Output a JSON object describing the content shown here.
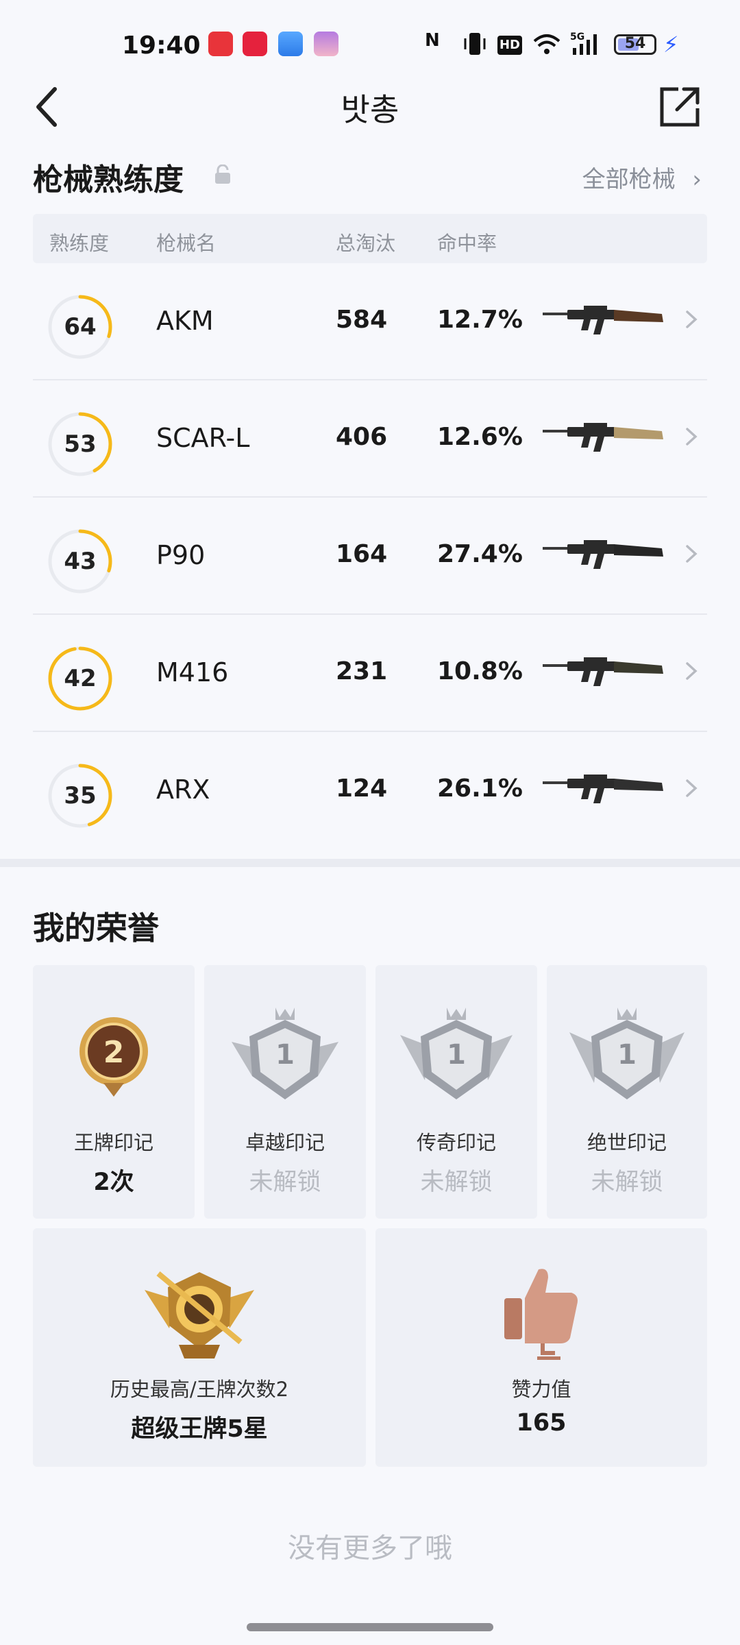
{
  "status_bar": {
    "time": "19:40",
    "battery": "54",
    "icons": [
      "nfc-icon",
      "vibrate-icon",
      "hd-icon",
      "wifi-icon",
      "5g-signal-icon",
      "battery-icon",
      "charging-icon"
    ]
  },
  "nav": {
    "title": "밧총",
    "back_icon": "chevron-left-icon",
    "share_icon": "share-icon"
  },
  "guns": {
    "heading": "枪械熟练度",
    "all_link": "全部枪械",
    "columns": [
      "熟练度",
      "枪械名",
      "总淘汰",
      "命中率"
    ],
    "rows": [
      {
        "level": "64",
        "level_value": 64,
        "name": "AKM",
        "kills": "584",
        "rate": "12.7%",
        "image": "akm-rifle-icon"
      },
      {
        "level": "53",
        "level_value": 53,
        "name": "SCAR-L",
        "kills": "406",
        "rate": "12.6%",
        "image": "scar-l-rifle-icon"
      },
      {
        "level": "43",
        "level_value": 43,
        "name": "P90",
        "kills": "164",
        "rate": "27.4%",
        "image": "p90-smg-icon"
      },
      {
        "level": "42",
        "level_value": 42,
        "name": "M416",
        "kills": "231",
        "rate": "10.8%",
        "image": "m416-rifle-icon"
      },
      {
        "level": "35",
        "level_value": 35,
        "name": "ARX",
        "kills": "124",
        "rate": "26.1%",
        "image": "arx-rifle-icon"
      }
    ],
    "ring_progress": [
      0.3,
      0.42,
      0.3,
      0.97,
      0.45
    ]
  },
  "honor": {
    "heading": "我的荣誉",
    "marks": [
      {
        "label": "王牌印记",
        "value": "2次",
        "badge_text": "2",
        "locked": false
      },
      {
        "label": "卓越印记",
        "value": "未解锁",
        "badge_text": "1",
        "locked": true
      },
      {
        "label": "传奇印记",
        "value": "未解锁",
        "badge_text": "1",
        "locked": true
      },
      {
        "label": "绝世印记",
        "value": "未解锁",
        "badge_text": "1",
        "locked": true
      }
    ],
    "best": {
      "label": "历史最高/王牌次数2",
      "value": "超级王牌5星"
    },
    "likes": {
      "label": "赞力值",
      "value": "165"
    }
  },
  "footer": {
    "no_more": "没有更多了哦"
  },
  "colors": {
    "ring": "#f6b919",
    "ring_track": "#e8eaef",
    "background": "#f7f8fc",
    "card": "#eef0f6"
  }
}
